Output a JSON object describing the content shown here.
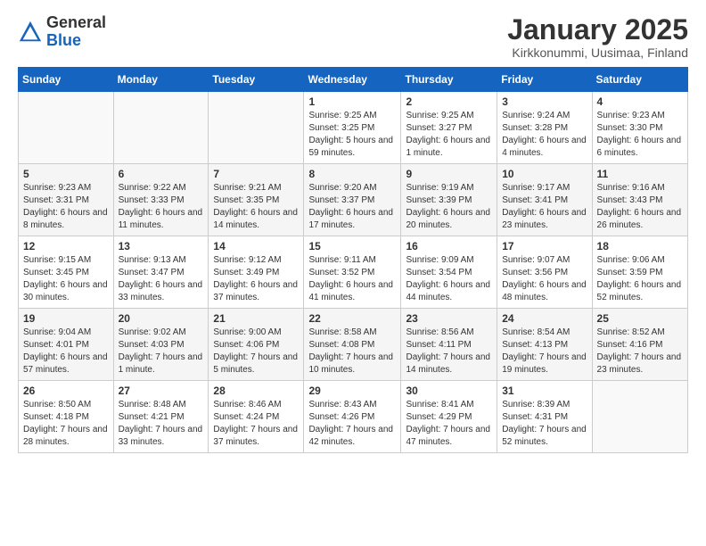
{
  "header": {
    "logo": {
      "general": "General",
      "blue": "Blue"
    },
    "title": "January 2025",
    "subtitle": "Kirkkonummi, Uusimaa, Finland"
  },
  "days_of_week": [
    "Sunday",
    "Monday",
    "Tuesday",
    "Wednesday",
    "Thursday",
    "Friday",
    "Saturday"
  ],
  "weeks": [
    [
      {
        "num": "",
        "info": ""
      },
      {
        "num": "",
        "info": ""
      },
      {
        "num": "",
        "info": ""
      },
      {
        "num": "1",
        "info": "Sunrise: 9:25 AM\nSunset: 3:25 PM\nDaylight: 5 hours\nand 59 minutes."
      },
      {
        "num": "2",
        "info": "Sunrise: 9:25 AM\nSunset: 3:27 PM\nDaylight: 6 hours\nand 1 minute."
      },
      {
        "num": "3",
        "info": "Sunrise: 9:24 AM\nSunset: 3:28 PM\nDaylight: 6 hours\nand 4 minutes."
      },
      {
        "num": "4",
        "info": "Sunrise: 9:23 AM\nSunset: 3:30 PM\nDaylight: 6 hours\nand 6 minutes."
      }
    ],
    [
      {
        "num": "5",
        "info": "Sunrise: 9:23 AM\nSunset: 3:31 PM\nDaylight: 6 hours\nand 8 minutes."
      },
      {
        "num": "6",
        "info": "Sunrise: 9:22 AM\nSunset: 3:33 PM\nDaylight: 6 hours\nand 11 minutes."
      },
      {
        "num": "7",
        "info": "Sunrise: 9:21 AM\nSunset: 3:35 PM\nDaylight: 6 hours\nand 14 minutes."
      },
      {
        "num": "8",
        "info": "Sunrise: 9:20 AM\nSunset: 3:37 PM\nDaylight: 6 hours\nand 17 minutes."
      },
      {
        "num": "9",
        "info": "Sunrise: 9:19 AM\nSunset: 3:39 PM\nDaylight: 6 hours\nand 20 minutes."
      },
      {
        "num": "10",
        "info": "Sunrise: 9:17 AM\nSunset: 3:41 PM\nDaylight: 6 hours\nand 23 minutes."
      },
      {
        "num": "11",
        "info": "Sunrise: 9:16 AM\nSunset: 3:43 PM\nDaylight: 6 hours\nand 26 minutes."
      }
    ],
    [
      {
        "num": "12",
        "info": "Sunrise: 9:15 AM\nSunset: 3:45 PM\nDaylight: 6 hours\nand 30 minutes."
      },
      {
        "num": "13",
        "info": "Sunrise: 9:13 AM\nSunset: 3:47 PM\nDaylight: 6 hours\nand 33 minutes."
      },
      {
        "num": "14",
        "info": "Sunrise: 9:12 AM\nSunset: 3:49 PM\nDaylight: 6 hours\nand 37 minutes."
      },
      {
        "num": "15",
        "info": "Sunrise: 9:11 AM\nSunset: 3:52 PM\nDaylight: 6 hours\nand 41 minutes."
      },
      {
        "num": "16",
        "info": "Sunrise: 9:09 AM\nSunset: 3:54 PM\nDaylight: 6 hours\nand 44 minutes."
      },
      {
        "num": "17",
        "info": "Sunrise: 9:07 AM\nSunset: 3:56 PM\nDaylight: 6 hours\nand 48 minutes."
      },
      {
        "num": "18",
        "info": "Sunrise: 9:06 AM\nSunset: 3:59 PM\nDaylight: 6 hours\nand 52 minutes."
      }
    ],
    [
      {
        "num": "19",
        "info": "Sunrise: 9:04 AM\nSunset: 4:01 PM\nDaylight: 6 hours\nand 57 minutes."
      },
      {
        "num": "20",
        "info": "Sunrise: 9:02 AM\nSunset: 4:03 PM\nDaylight: 7 hours\nand 1 minute."
      },
      {
        "num": "21",
        "info": "Sunrise: 9:00 AM\nSunset: 4:06 PM\nDaylight: 7 hours\nand 5 minutes."
      },
      {
        "num": "22",
        "info": "Sunrise: 8:58 AM\nSunset: 4:08 PM\nDaylight: 7 hours\nand 10 minutes."
      },
      {
        "num": "23",
        "info": "Sunrise: 8:56 AM\nSunset: 4:11 PM\nDaylight: 7 hours\nand 14 minutes."
      },
      {
        "num": "24",
        "info": "Sunrise: 8:54 AM\nSunset: 4:13 PM\nDaylight: 7 hours\nand 19 minutes."
      },
      {
        "num": "25",
        "info": "Sunrise: 8:52 AM\nSunset: 4:16 PM\nDaylight: 7 hours\nand 23 minutes."
      }
    ],
    [
      {
        "num": "26",
        "info": "Sunrise: 8:50 AM\nSunset: 4:18 PM\nDaylight: 7 hours\nand 28 minutes."
      },
      {
        "num": "27",
        "info": "Sunrise: 8:48 AM\nSunset: 4:21 PM\nDaylight: 7 hours\nand 33 minutes."
      },
      {
        "num": "28",
        "info": "Sunrise: 8:46 AM\nSunset: 4:24 PM\nDaylight: 7 hours\nand 37 minutes."
      },
      {
        "num": "29",
        "info": "Sunrise: 8:43 AM\nSunset: 4:26 PM\nDaylight: 7 hours\nand 42 minutes."
      },
      {
        "num": "30",
        "info": "Sunrise: 8:41 AM\nSunset: 4:29 PM\nDaylight: 7 hours\nand 47 minutes."
      },
      {
        "num": "31",
        "info": "Sunrise: 8:39 AM\nSunset: 4:31 PM\nDaylight: 7 hours\nand 52 minutes."
      },
      {
        "num": "",
        "info": ""
      }
    ]
  ]
}
